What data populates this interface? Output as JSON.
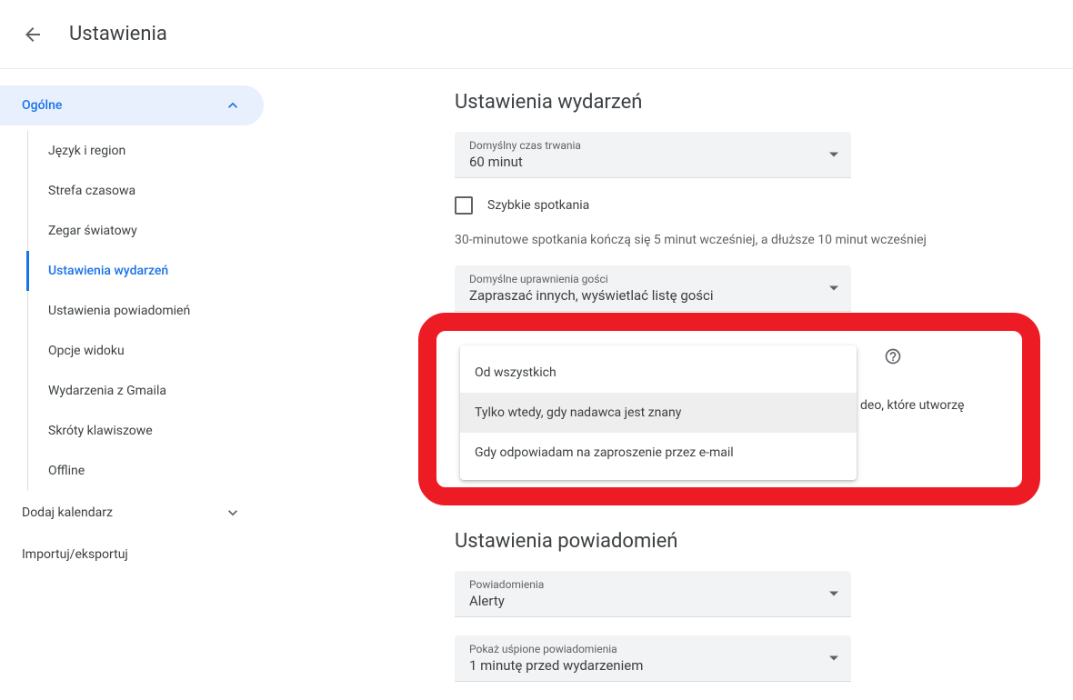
{
  "header": {
    "title": "Ustawienia"
  },
  "sidebar": {
    "group_label": "Ogólne",
    "subitems": [
      "Język i region",
      "Strefa czasowa",
      "Zegar światowy",
      "Ustawienia wydarzeń",
      "Ustawienia powiadomień",
      "Opcje widoku",
      "Wydarzenia z Gmaila",
      "Skróty klawiszowe",
      "Offline"
    ],
    "active_index": 3,
    "add_calendar": "Dodaj kalendarz",
    "import_export": "Importuj/eksportuj"
  },
  "main": {
    "events_section": {
      "title": "Ustawienia wydarzeń",
      "duration_label": "Domyślny czas trwania",
      "duration_value": "60 minut",
      "speedy_label": "Szybkie spotkania",
      "speedy_info": "30-minutowe spotkania kończą się 5 minut wcześniej, a dłuższe 10 minut wcześniej",
      "guest_perm_label": "Domyślne uprawnienia gości",
      "guest_perm_value": "Zapraszać innych, wyświetlać listę gości",
      "side_text": "deo, które utworzę"
    },
    "dropdown": {
      "options": [
        "Od wszystkich",
        "Tylko wtedy, gdy nadawca jest znany",
        "Gdy odpowiadam na zaproszenie przez e-mail"
      ],
      "selected_index": 1
    },
    "notif_section": {
      "title": "Ustawienia powiadomień",
      "notif_label": "Powiadomienia",
      "notif_value": "Alerty",
      "snoozed_label": "Pokaż uśpione powiadomienia",
      "snoozed_value": "1 minutę przed wydarzeniem"
    }
  }
}
